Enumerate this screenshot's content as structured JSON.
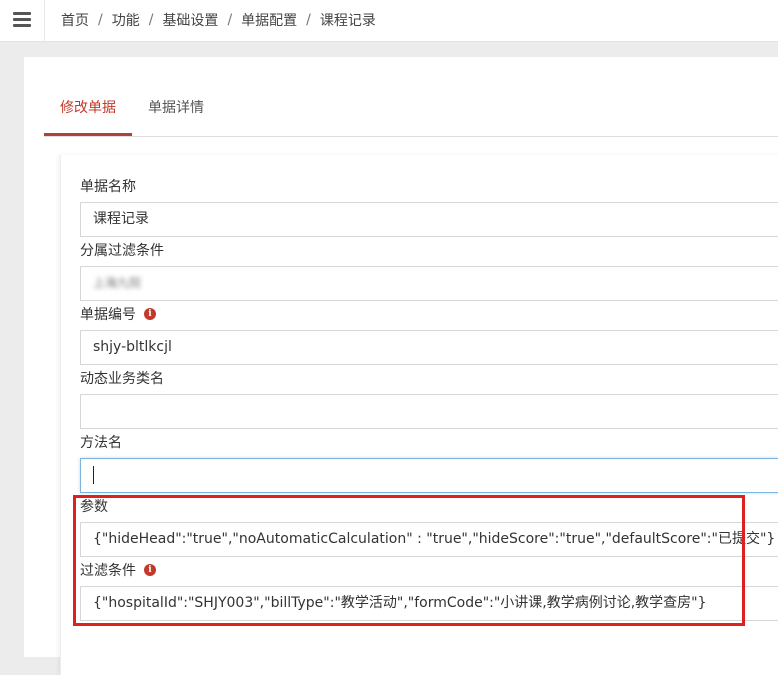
{
  "breadcrumb": [
    "首页",
    "功能",
    "基础设置",
    "单据配置",
    "课程记录"
  ],
  "tabs": {
    "edit": "修改单据",
    "detail": "单据详情"
  },
  "form": {
    "name_label": "单据名称",
    "name_value": "课程记录",
    "filter_label": "分属过滤条件",
    "filter_value": "上海九院",
    "code_label": "单据编号",
    "code_value": "shjy-bltlkcjl",
    "dynamic_label": "动态业务类名",
    "dynamic_value": "",
    "method_label": "方法名",
    "method_value": "",
    "params_label": "参数",
    "params_value": "{\"hideHead\":\"true\",\"noAutomaticCalculation\" : \"true\",\"hideScore\":\"true\",\"defaultScore\":\"已提交\"}",
    "conditions_label": "过滤条件",
    "conditions_value": "{\"hospitalId\":\"SHJY003\",\"billType\":\"教学活动\",\"formCode\":\"小讲课,教学病例讨论,教学查房\"}"
  },
  "icons": {
    "menu": "hamburger-menu-icon",
    "info": "info-circle-icon"
  },
  "colors": {
    "accent": "#c0392b",
    "highlight": "#e02020",
    "focus": "#7cb3df"
  }
}
